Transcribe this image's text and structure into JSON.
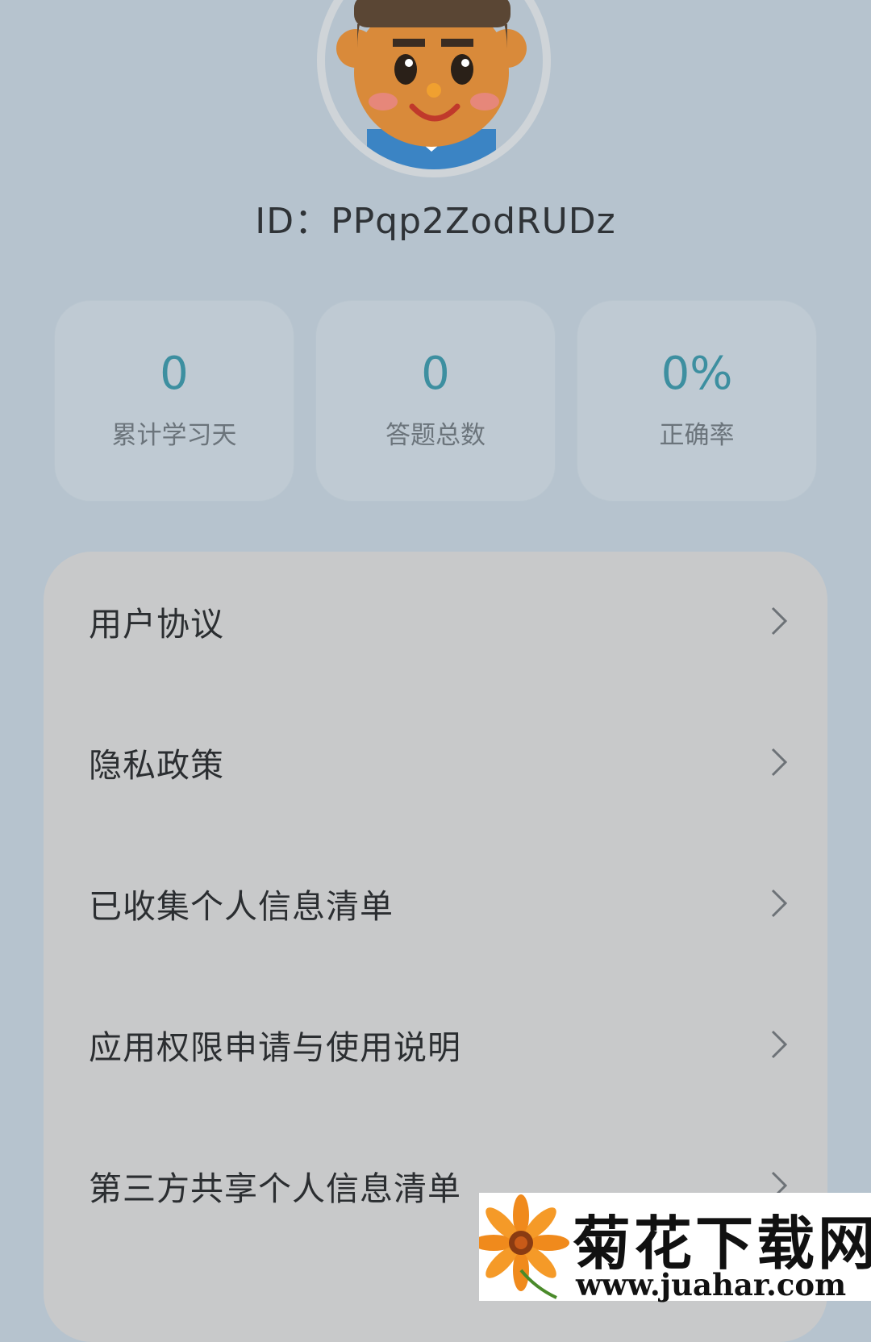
{
  "profile": {
    "id_text": "ID：PPqp2ZodRUDz"
  },
  "stats": [
    {
      "value": "0",
      "label": "累计学习天"
    },
    {
      "value": "0",
      "label": "答题总数"
    },
    {
      "value": "0%",
      "label": "正确率"
    }
  ],
  "menu": {
    "items": [
      {
        "label": "用户协议"
      },
      {
        "label": "隐私政策"
      },
      {
        "label": "已收集个人信息清单"
      },
      {
        "label": "应用权限申请与使用说明"
      },
      {
        "label": "第三方共享个人信息清单"
      }
    ]
  },
  "watermark": {
    "title": "菊花下载网",
    "url": "www.juahar.com"
  },
  "colors": {
    "background": "#b6c3ce",
    "stat_value": "#3d8fa0",
    "menu_card": "#c8c9ca"
  }
}
